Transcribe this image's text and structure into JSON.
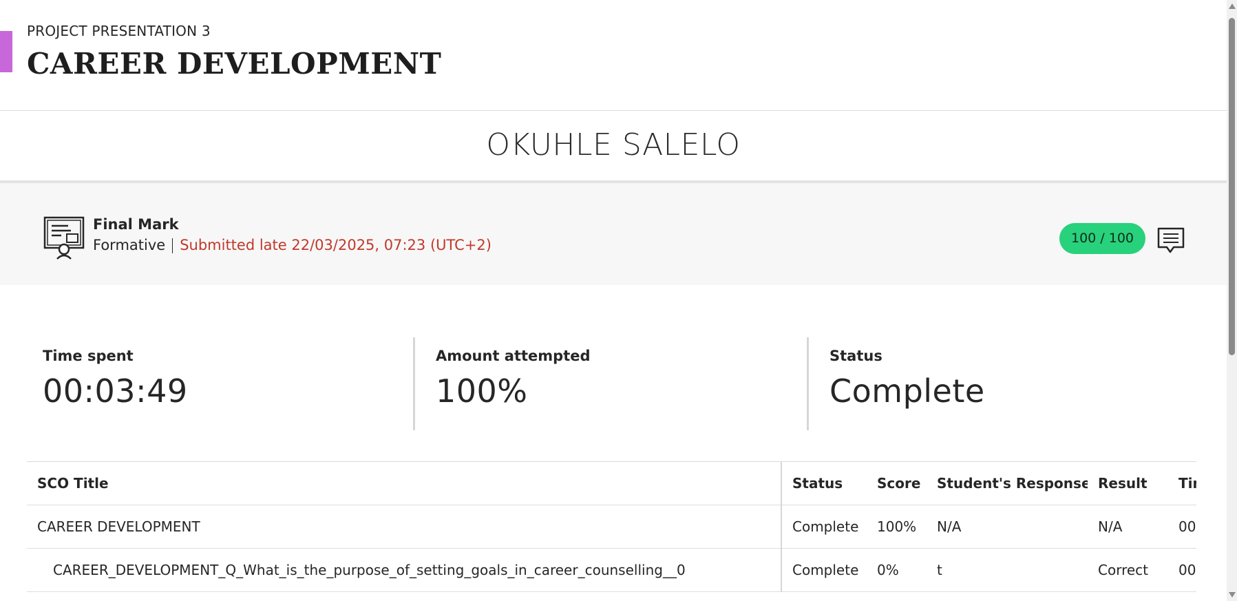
{
  "header": {
    "eyebrow": "PROJECT PRESENTATION 3",
    "title": "CAREER DEVELOPMENT",
    "accent_color": "#c867d9"
  },
  "student": {
    "name": "OKUHLE SALELO"
  },
  "grade": {
    "icon": "certificate-icon",
    "label": "Final Mark",
    "type": "Formative",
    "submission": "Submitted late 22/03/2025, 07:23 (UTC+2)",
    "score": "100 / 100",
    "pill_color": "#28d17c",
    "feedback_icon": "comment-icon"
  },
  "summary": [
    {
      "label": "Time spent",
      "value": "00:03:49"
    },
    {
      "label": "Amount attempted",
      "value": "100%"
    },
    {
      "label": "Status",
      "value": "Complete"
    }
  ],
  "table": {
    "columns": [
      "SCO Title",
      "Status",
      "Score",
      "Student's Response",
      "Result",
      "Time"
    ],
    "rows": [
      {
        "title": "CAREER DEVELOPMENT",
        "status": "Complete",
        "score": "100%",
        "response": "N/A",
        "result": "N/A",
        "time": "00"
      },
      {
        "title": "CAREER_DEVELOPMENT_Q_What_is_the_purpose_of_setting_goals_in_career_counselling__0",
        "status": "Complete",
        "score": "0%",
        "response": "t",
        "result": "Correct",
        "time": "00"
      }
    ]
  }
}
